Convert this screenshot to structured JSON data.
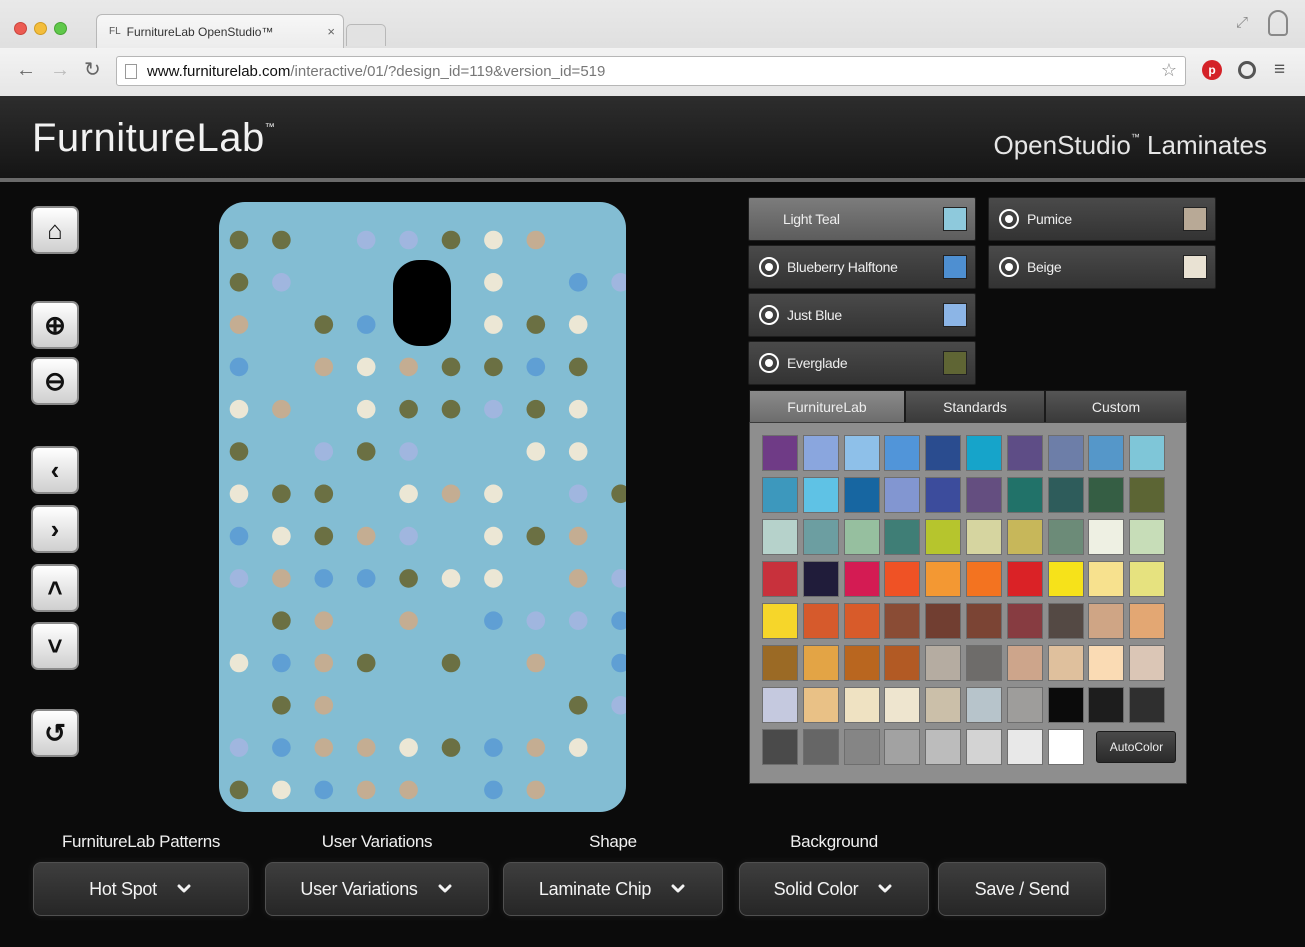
{
  "browser": {
    "tab_title": "FurnitureLab OpenStudio™",
    "tab_favicon": "FL",
    "tab_close": "×",
    "url_host": "www.furniturelab.com",
    "url_path": "/interactive/01/?design_id=119&version_id=519"
  },
  "header": {
    "logo": "FurnitureLab",
    "logo_mark": "™",
    "subtitle": "OpenStudio",
    "subtitle_mark": "™",
    "subtitle_suffix": " Laminates"
  },
  "tools": [
    {
      "name": "home-icon",
      "glyph": "⌂"
    },
    {
      "name": "zoom-in-icon",
      "glyph": "⊕"
    },
    {
      "name": "zoom-out-icon",
      "glyph": "⊖"
    },
    {
      "name": "arrow-left-icon",
      "glyph": "‹"
    },
    {
      "name": "arrow-right-icon",
      "glyph": "›"
    },
    {
      "name": "arrow-up-icon",
      "glyph": "˄"
    },
    {
      "name": "arrow-down-icon",
      "glyph": "˅"
    },
    {
      "name": "reset-icon",
      "glyph": "↺"
    }
  ],
  "canvas": {
    "background": "#83bdd3",
    "dot_colors": {
      "g": "#6b7043",
      "b": "#5f9fd4",
      "l": "#a0b6df",
      "t": "#c4ad92",
      "c": "#ece7d5"
    },
    "rows": [
      "g g . l l g c t . .",
      "g l . . l . c . b l",
      "t . g b . . c g c .",
      "b . t c t g g b g .",
      "c t . c g g l g c .",
      "g . l g l . . c c .",
      "c g g . c t c . l g",
      "b c g t l . c g t .",
      "l t b b g c c . t l",
      ". g t . t . b l l b",
      "c b t g . g . t . b",
      ". g t . . . . . g l",
      "l b t t c g b t c .",
      "g c b t t . b t . ."
    ],
    "cutout_color": "#000000"
  },
  "slots": [
    {
      "label": "Light Teal",
      "color": "#8ec9dc",
      "active": true
    },
    {
      "label": "Blueberry Halftone",
      "color": "#4e8fd1",
      "active": false
    },
    {
      "label": "Just Blue",
      "color": "#8cb5e6",
      "active": false
    },
    {
      "label": "Everglade",
      "color": "#5f6534",
      "active": false
    },
    {
      "label": "Pumice",
      "color": "#b8a996",
      "active": false
    },
    {
      "label": "Beige",
      "color": "#e9e2d3",
      "active": false
    }
  ],
  "palette_tabs": [
    "FurnitureLab",
    "Standards",
    "Custom"
  ],
  "swatches": [
    [
      "#6f3b86",
      "#8aa6de",
      "#8ec0e9",
      "#5195d9",
      "#2a4c8f",
      "#16a4ca",
      "#5e4d86",
      "#6d7ea8",
      "#5597c9",
      "#7fc6d8"
    ],
    [
      "#3d98bd",
      "#5fc2e5",
      "#1766a1",
      "#8296d1",
      "#3c4c9c",
      "#644e80",
      "#217269",
      "#2e5c5b",
      "#355e44",
      "#5c6534"
    ],
    [
      "#b6d2cb",
      "#6c9ea1",
      "#96bf9f",
      "#3f7e76",
      "#b6c52d",
      "#d6d5a0",
      "#c7b75a",
      "#6c8b78",
      "#eef0e3",
      "#c7ddb8"
    ],
    [
      "#c8313c",
      "#201c3a",
      "#d41b53",
      "#ef5225",
      "#f39833",
      "#f37320",
      "#da2226",
      "#f6e21a",
      "#f7e18e",
      "#e6e27f"
    ],
    [
      "#f6d62a",
      "#d65a2c",
      "#d85b2a",
      "#8a4c35",
      "#713e31",
      "#7b4434",
      "#873c41",
      "#544944",
      "#cfa585",
      "#e3a773"
    ],
    [
      "#9b6a25",
      "#e3a445",
      "#b9661f",
      "#b25a24",
      "#b5aca1",
      "#6e6c6a",
      "#cda58b",
      "#dfc09d",
      "#fadbb4",
      "#dbc6b6"
    ],
    [
      "#c5c9df",
      "#e9c186",
      "#efe2c2",
      "#eee5cf",
      "#cbbfa9",
      "#b7c4cb",
      "#9e9d9b",
      "#0b0b0b",
      "#1d1d1d",
      "#2f2f2f"
    ],
    [
      "#4a4a4a",
      "#666666",
      "#858585",
      "#a2a2a2",
      "#bcbcbc",
      "#d3d3d3",
      "#e8e8e8",
      "#ffffff"
    ]
  ],
  "autocolor_label": "AutoColor",
  "controls": [
    {
      "label": "FurnitureLab Patterns",
      "value": "Hot Spot"
    },
    {
      "label": "User Variations",
      "value": "User Variations"
    },
    {
      "label": "Shape",
      "value": "Laminate Chip"
    },
    {
      "label": "Background",
      "value": "Solid Color"
    }
  ],
  "save_label": "Save / Send"
}
